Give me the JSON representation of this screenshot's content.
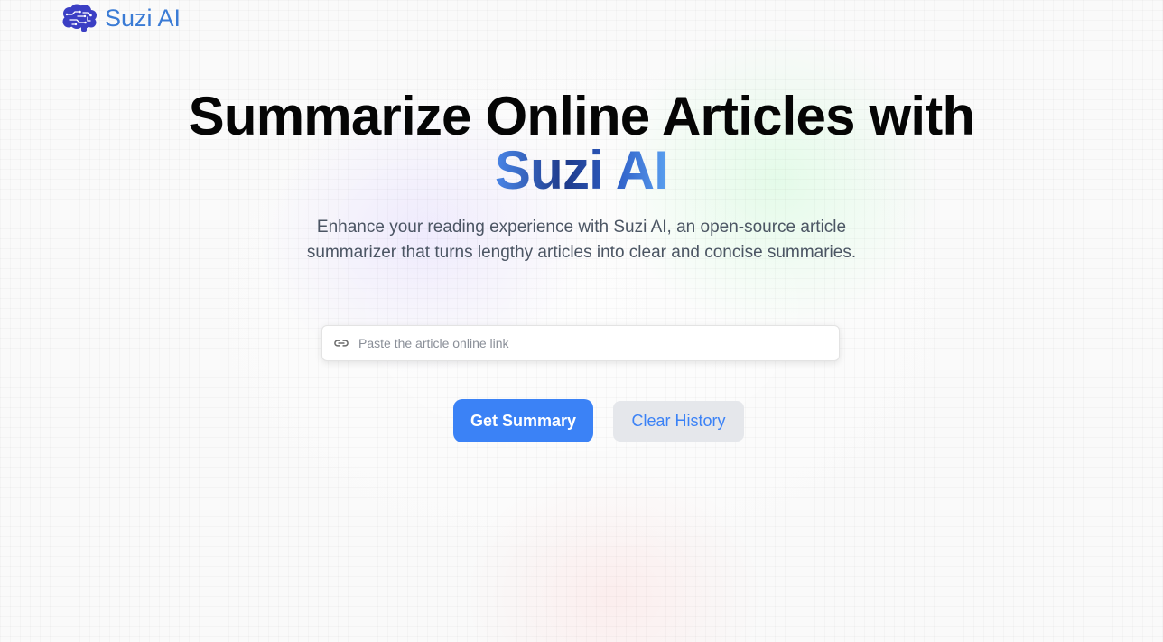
{
  "navbar": {
    "logo_icon": "brain-icon",
    "brand_name": "Suzi AI"
  },
  "hero": {
    "headline": "Summarize Online Articles with",
    "headline_accent": "Suzi AI",
    "description": "Enhance your reading experience with Suzi AI, an open-source article summarizer that turns lengthy articles into clear and concise summaries."
  },
  "search": {
    "icon": "link-icon",
    "value": "",
    "placeholder": "Paste the article online link"
  },
  "actions": {
    "get_summary_label": "Get Summary",
    "clear_history_label": "Clear History"
  },
  "colors": {
    "accent": "#3b82f6",
    "brand_text": "#3a7bd5",
    "logo": "#3b3fc4",
    "headline": "#050505",
    "body_text": "#4b5563",
    "secondary_button_bg": "#e5e7eb"
  }
}
